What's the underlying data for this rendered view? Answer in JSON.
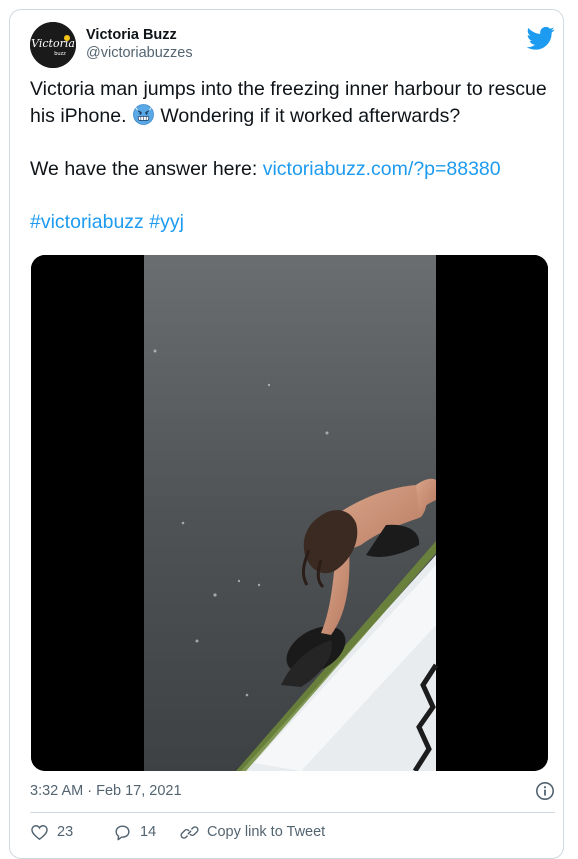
{
  "author": {
    "display_name": "Victoria Buzz",
    "handle": "@victoriabuzzes",
    "avatar_text": "Victoria",
    "avatar_subtext": "buzz"
  },
  "tweet": {
    "line1": "Victoria man jumps into the freezing inner harbour to rescue his iPhone.",
    "emoji": "cold-face-emoji",
    "line1_rest": "Wondering if it worked afterwards?",
    "answer_prefix": "We have the answer here: ",
    "answer_link": "victoriabuzz.com/?p=88380",
    "hashtag1": "#victoriabuzz",
    "hashtag2": "#yyj"
  },
  "meta": {
    "timestamp": "3:32 AM · Feb 17, 2021"
  },
  "actions": {
    "likes": "23",
    "replies": "14",
    "copy_link": "Copy link to Tweet"
  },
  "colors": {
    "link": "#1d9bf0",
    "secondary_text": "#536471",
    "border": "#cfd9de"
  }
}
